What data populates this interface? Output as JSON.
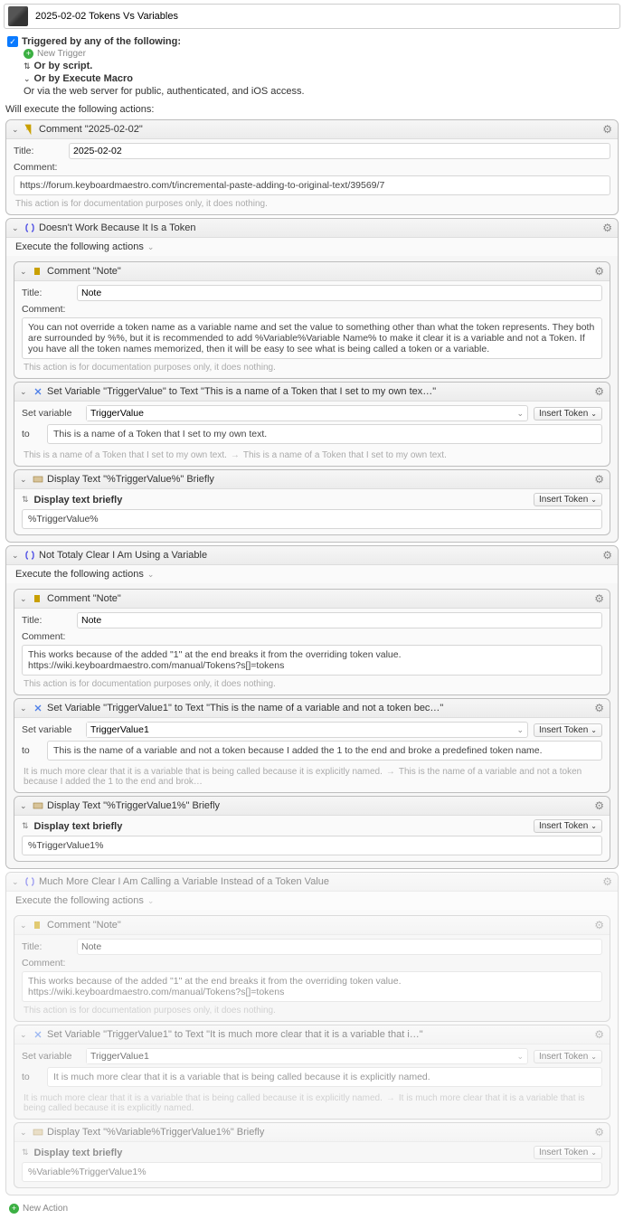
{
  "header": {
    "macro_title": "2025-02-02 Tokens Vs Variables"
  },
  "triggers": {
    "heading": "Triggered by any of the following:",
    "new_trigger": "New Trigger",
    "or_script": "Or by script.",
    "or_exec_macro": "Or by Execute Macro",
    "or_web": "Or via the web server for public, authenticated, and iOS access.",
    "actions_heading": "Will execute the following actions:"
  },
  "labels": {
    "title": "Title:",
    "comment": "Comment:",
    "set_variable": "Set variable",
    "to": "to",
    "insert_token": "Insert Token",
    "display_text_briefly": "Display text briefly",
    "execute_following": "Execute the following actions"
  },
  "action1": {
    "title": "Comment \"2025-02-02\"",
    "title_value": "2025-02-02",
    "comment_value": "https://forum.keyboardmaestro.com/t/incremental-paste-adding-to-original-text/39569/7",
    "doc_hint": "This action is for documentation purposes only, it does nothing."
  },
  "group1": {
    "title": "Doesn't Work Because It Is a Token",
    "comment_title": "Comment \"Note\"",
    "note_title": "Note",
    "note_body": "You can not override a token name as a variable name and set the value to something other than what the token represents. They both are surrounded by %%, but it is recommended to add %Variable%Variable Name% to make it clear it is a variable and not a Token. If you have all the token names memorized, then it will be easy to see what is being called a token or a variable.",
    "setvar_title": "Set Variable \"TriggerValue\" to Text \"This is a name of a Token that I set to my own tex…\"",
    "setvar_name": "TriggerValue",
    "setvar_value": "This is a name of a Token that I set to my own text.",
    "setvar_hint_left": "This is a name of a Token that I set to my own text.",
    "setvar_hint_right": "This is a name of a Token that I set to my own text.",
    "display_title": "Display Text \"%TriggerValue%\" Briefly",
    "display_value": "%TriggerValue%"
  },
  "group2": {
    "title": "Not Totaly Clear I Am Using a Variable",
    "comment_title": "Comment \"Note\"",
    "note_title": "Note",
    "note_body": "This works because of the added \"1\" at the end breaks it from the overriding token value. https://wiki.keyboardmaestro.com/manual/Tokens?s[]=tokens",
    "setvar_title": "Set Variable \"TriggerValue1\" to Text \"This is the name of a variable and not a token bec…\"",
    "setvar_name": "TriggerValue1",
    "setvar_value": "This is the name of a variable and not a token because I added the 1 to the end and broke a predefined token name.",
    "setvar_hint_left": "It is much more clear that it is a variable that is being called because it is explicitly named.",
    "setvar_hint_right": "This is the name of a variable and not a token because I added the 1 to the end and brok…",
    "display_title": "Display Text \"%TriggerValue1%\" Briefly",
    "display_value": "%TriggerValue1%"
  },
  "group3": {
    "title": "Much More Clear I Am Calling a Variable Instead of a Token Value",
    "comment_title": "Comment \"Note\"",
    "note_title": "Note",
    "note_body": "This works because of the added \"1\" at the end breaks it from the overriding token value. https://wiki.keyboardmaestro.com/manual/Tokens?s[]=tokens",
    "setvar_title": "Set Variable \"TriggerValue1\" to Text \"It is much more clear that it is a variable that i…\"",
    "setvar_name": "TriggerValue1",
    "setvar_value": "It is much more clear that it is a variable that is being called because it is explicitly named.",
    "setvar_hint_left": "It is much more clear that it is a variable that is being called because it is explicitly named.",
    "setvar_hint_right": "It is much more clear that it is a variable that is being called because it is explicitly named.",
    "display_title": "Display Text \"%Variable%TriggerValue1%\" Briefly",
    "display_value": "%Variable%TriggerValue1%"
  },
  "footer": {
    "new_action": "New Action"
  }
}
